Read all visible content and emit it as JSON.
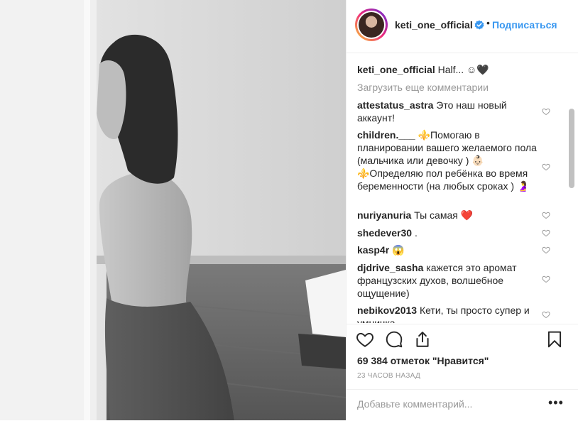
{
  "post": {
    "photo": {
      "alt": "",
      "description": ""
    },
    "header": {
      "username": "keti_one_official",
      "verified_icon": "verified-badge-icon",
      "separator": "•",
      "follow_label": "Подписаться"
    },
    "caption": {
      "username": "keti_one_official",
      "text": "Half... ☺︎🖤"
    },
    "load_more": "Загрузить еще комментарии",
    "comments": [
      {
        "username": "attestatus_astra",
        "text": "Это наш новый аккаунт!"
      },
      {
        "username": "children.___",
        "text": "⚜️Помогаю в планировании вашего желаемого пола (мальчика или девочку ) 👶🏻 ⚜️Определяю пол ребёнка во время беременности (на любых сроках ) 🤰"
      },
      {
        "username": "nuriyanuria",
        "text": "Ты самая ❤️"
      },
      {
        "username": "shedever30",
        "text": "."
      },
      {
        "username": "kasp4r",
        "text": "😱"
      },
      {
        "username": "djdrive_sasha",
        "text": "кажется это аромат французских духов, волшебное ощущение)"
      },
      {
        "username": "nebikov2013",
        "text": "Кети, ты просто супер и умничка"
      }
    ],
    "likes_text": "69 384 отметок \"Нравится\"",
    "time_text": "23 ЧАСОВ НАЗАД",
    "add_comment_placeholder": "Добавьте комментарий...",
    "more_label": "•••",
    "icons": {
      "like": "heart-icon",
      "comment": "comment-icon",
      "share": "share-icon",
      "save": "bookmark-icon",
      "comment_like": "heart-small-icon"
    },
    "colors": {
      "link": "#3897f0",
      "muted": "#999999",
      "text": "#262626",
      "border": "#efefef"
    }
  }
}
